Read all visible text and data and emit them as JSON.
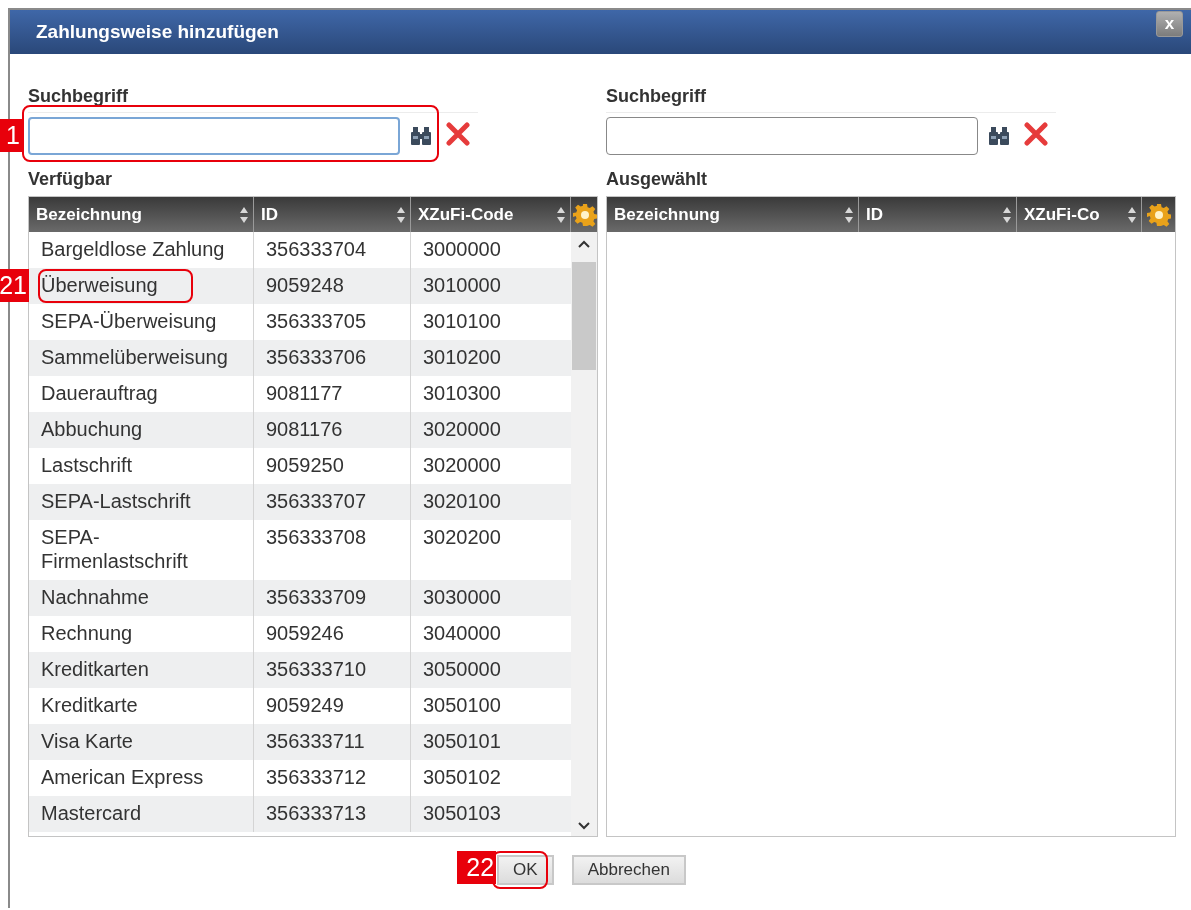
{
  "window": {
    "title": "Zahlungsweise hinzufügen",
    "close": "x"
  },
  "available": {
    "search_label": "Suchbegriff",
    "search": {
      "focused": true,
      "callout": "1"
    },
    "title": "Verfügbar",
    "columns": [
      "Bezeichnung",
      "ID",
      "XZuFi-Code"
    ],
    "rows": [
      {
        "cells": [
          "Bargeldlose Zahlung",
          "356333704",
          "3000000"
        ]
      },
      {
        "cells": [
          "Überweisung",
          "9059248",
          "3010000"
        ],
        "callout": "21"
      },
      {
        "cells": [
          "SEPA-Überweisung",
          "356333705",
          "3010100"
        ]
      },
      {
        "cells": [
          "Sammelüberweisung",
          "356333706",
          "3010200"
        ]
      },
      {
        "cells": [
          "Dauerauftrag",
          "9081177",
          "3010300"
        ]
      },
      {
        "cells": [
          "Abbuchung",
          "9081176",
          "3020000"
        ]
      },
      {
        "cells": [
          "Lastschrift",
          "9059250",
          "3020000"
        ]
      },
      {
        "cells": [
          "SEPA-Lastschrift",
          "356333707",
          "3020100"
        ]
      },
      {
        "cells": [
          "SEPA-Firmenlastschrift",
          "356333708",
          "3020200"
        ]
      },
      {
        "cells": [
          "Nachnahme",
          "356333709",
          "3030000"
        ]
      },
      {
        "cells": [
          "Rechnung",
          "9059246",
          "3040000"
        ]
      },
      {
        "cells": [
          "Kreditkarten",
          "356333710",
          "3050000"
        ]
      },
      {
        "cells": [
          "Kreditkarte",
          "9059249",
          "3050100"
        ]
      },
      {
        "cells": [
          "Visa Karte",
          "356333711",
          "3050101"
        ]
      },
      {
        "cells": [
          "American Express",
          "356333712",
          "3050102"
        ]
      },
      {
        "cells": [
          "Mastercard",
          "356333713",
          "3050103"
        ]
      }
    ]
  },
  "selected": {
    "search_label": "Suchbegriff",
    "search": {
      "focused": false
    },
    "title": "Ausgewählt",
    "columns": [
      "Bezeichnung",
      "ID",
      "XZuFi-Co"
    ]
  },
  "buttons": [
    {
      "label": "OK",
      "callout": "22"
    },
    {
      "label": "Abbrechen"
    }
  ]
}
